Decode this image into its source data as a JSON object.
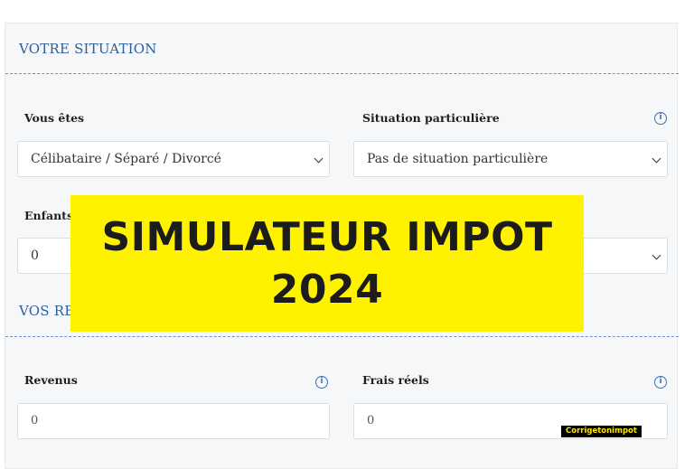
{
  "situation_section": {
    "title": "VOTRE SITUATION",
    "vous_etes": {
      "label": "Vous êtes",
      "value": "Célibataire / Séparé / Divorcé"
    },
    "situation_particuliere": {
      "label": "Situation particulière",
      "value": "Pas de situation particulière",
      "info_icon": "info-icon"
    },
    "enfants": {
      "label": "Enfants",
      "value": "0"
    }
  },
  "revenus_section": {
    "title": "VOS RE",
    "revenus": {
      "label": "Revenus",
      "value": "0",
      "info_icon": "info-icon"
    },
    "frais_reels": {
      "label": "Frais réels",
      "value": "0",
      "info_icon": "info-icon"
    }
  },
  "banner": {
    "line1": "SIMULATEUR IMPOT",
    "line2": "2024",
    "background": "#fff200"
  },
  "watermark": "Corrigetonimpot",
  "colors": {
    "accent": "#2b5fa0",
    "panel": "#f6f7f8"
  }
}
